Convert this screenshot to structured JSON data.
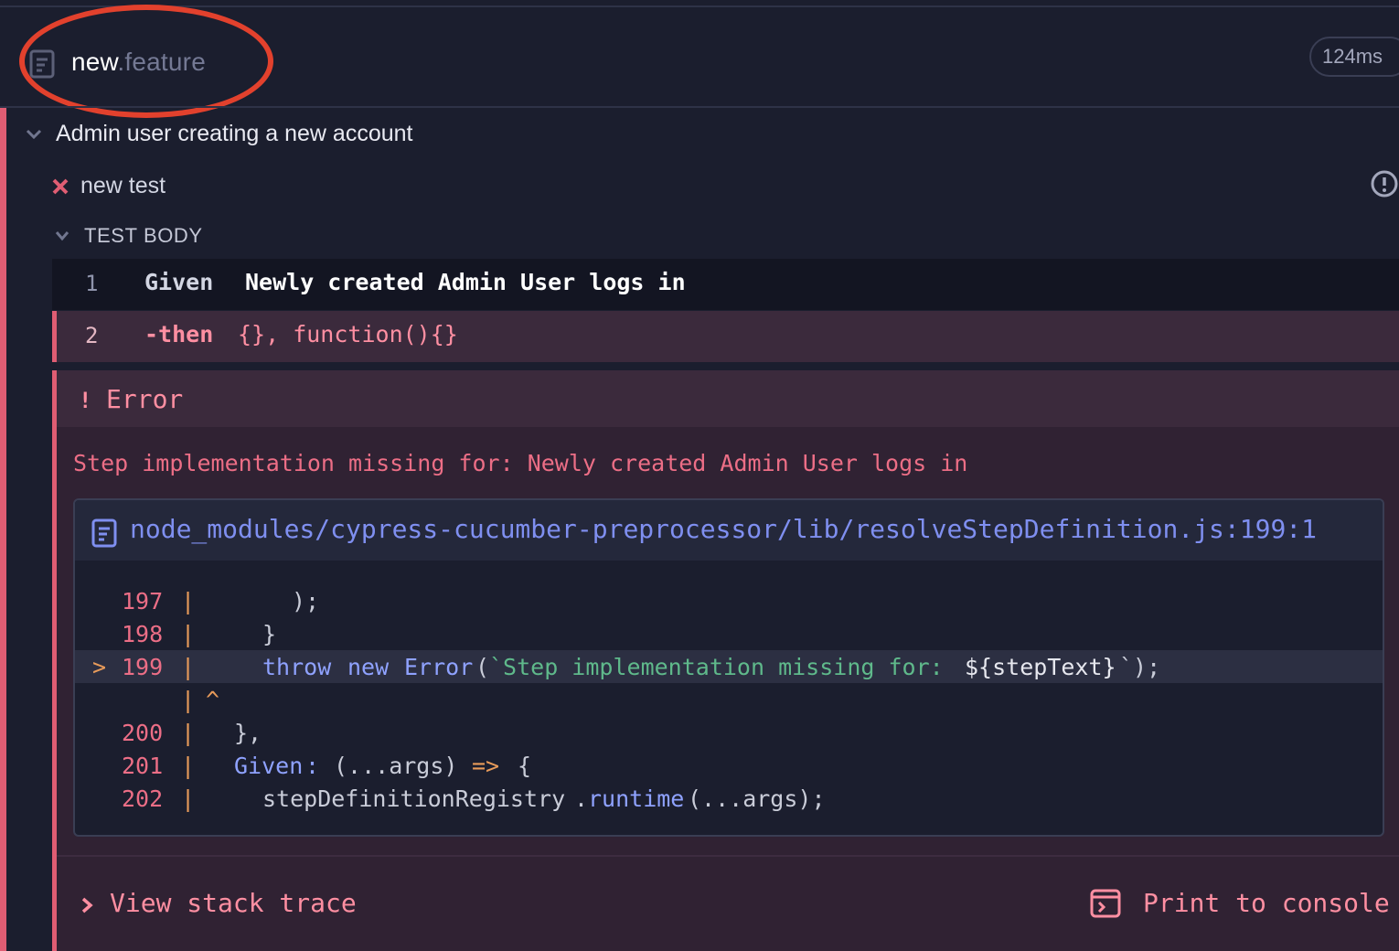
{
  "spec": {
    "name_base": "new",
    "name_ext": ".feature",
    "duration": "124ms"
  },
  "suite": {
    "title": "Admin user creating a new account"
  },
  "test": {
    "title": "new test"
  },
  "body": {
    "label": "TEST BODY"
  },
  "steps": [
    {
      "num": "1",
      "keyword": "Given",
      "text": "Newly created Admin User logs in"
    },
    {
      "num": "2",
      "keyword": "-then",
      "text": "{}, function(){}"
    }
  ],
  "error": {
    "bang": "!",
    "name": "Error",
    "message": "Step implementation missing for: Newly created Admin User logs in",
    "file_path": "node_modules/cypress-cucumber-preprocessor/lib/resolveStepDefinition.js:199:1",
    "code": {
      "pipe": "|",
      "marker": ">",
      "caret": "^",
      "lines": [
        {
          "num": "197",
          "t1": ");"
        },
        {
          "num": "198",
          "t1": "}"
        },
        {
          "num": "199",
          "kw1": "throw",
          "kw2": "new",
          "cls": "Error",
          "paren": "(",
          "str": "`Step implementation missing for: ",
          "tmpl": "${stepText}",
          "tail": "`);"
        },
        {
          "num": "200",
          "t1": "},"
        },
        {
          "num": "201",
          "key": "Given",
          "colon": ":",
          "args": "(...args)",
          "arrow": "=>",
          "brace": "{"
        },
        {
          "num": "202",
          "obj": "stepDefinitionRegistry",
          "dot": ".",
          "fn": "runtime",
          "call": "(...args);"
        }
      ]
    }
  },
  "footer": {
    "stack_trace_label": "View stack trace",
    "print_label": "Print to console"
  },
  "colors": {
    "background": "#1b1e2e",
    "fail_accent": "#e05d73",
    "error_text": "#ff8fa2",
    "link_blue": "#7f8ff0",
    "annotation_red": "#e2412d"
  }
}
